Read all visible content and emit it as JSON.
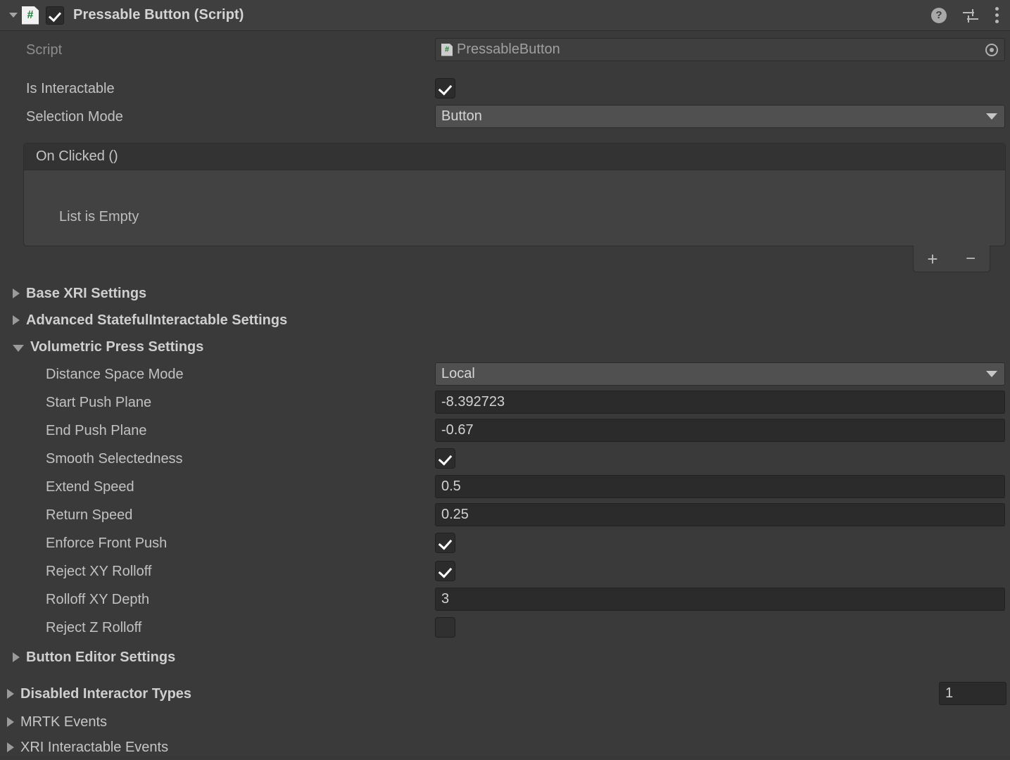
{
  "header": {
    "title": "Pressable Button (Script)",
    "enabled": true,
    "script_icon": "csharp-script-icon",
    "hash": "#",
    "icons": {
      "help": "?",
      "preset": "preset-icon",
      "menu": "kebab-menu-icon"
    }
  },
  "script_row": {
    "label": "Script",
    "value": "PressableButton",
    "hash": "#"
  },
  "fields": {
    "is_interactable": {
      "label": "Is Interactable",
      "value": true
    },
    "selection_mode": {
      "label": "Selection Mode",
      "value": "Button"
    }
  },
  "event_list": {
    "title": "On Clicked ()",
    "empty_text": "List is Empty",
    "add_label": "+",
    "remove_label": "−"
  },
  "sections": [
    {
      "label": "Base XRI Settings",
      "expanded": false,
      "bold": true
    },
    {
      "label": "Advanced StatefulInteractable Settings",
      "expanded": false,
      "bold": true
    },
    {
      "label": "Volumetric Press Settings",
      "expanded": true,
      "bold": true
    },
    {
      "label": "Button Editor Settings",
      "expanded": false,
      "bold": true
    },
    {
      "label": "Disabled Interactor Types",
      "expanded": false,
      "bold": true
    },
    {
      "label": "MRTK Events",
      "expanded": false,
      "bold": false
    },
    {
      "label": "XRI Interactable Events",
      "expanded": false,
      "bold": false
    }
  ],
  "volumetric": {
    "distance_space_mode": {
      "label": "Distance Space Mode",
      "value": "Local",
      "type": "dropdown"
    },
    "start_push_plane": {
      "label": "Start Push Plane",
      "value": "-8.392723",
      "type": "number"
    },
    "end_push_plane": {
      "label": "End Push Plane",
      "value": "-0.67",
      "type": "number"
    },
    "smooth_selectedness": {
      "label": "Smooth Selectedness",
      "value": true,
      "type": "checkbox"
    },
    "extend_speed": {
      "label": "Extend Speed",
      "value": "0.5",
      "type": "number"
    },
    "return_speed": {
      "label": "Return Speed",
      "value": "0.25",
      "type": "number"
    },
    "enforce_front_push": {
      "label": "Enforce Front Push",
      "value": true,
      "type": "checkbox"
    },
    "reject_xy_rolloff": {
      "label": "Reject XY Rolloff",
      "value": true,
      "type": "checkbox"
    },
    "rolloff_xy_depth": {
      "label": "Rolloff XY Depth",
      "value": "3",
      "type": "number"
    },
    "reject_z_rolloff": {
      "label": "Reject Z Rolloff",
      "value": false,
      "type": "checkbox"
    }
  },
  "disabled_interactor_types": {
    "size_value": "1"
  },
  "colors": {
    "background": "#3a3a3a",
    "header": "#3f3f3f",
    "field": "#2b2b2b",
    "dropdown": "#505050",
    "panel_body": "#424242",
    "panel_head": "#333333",
    "text": "#c2c2c2",
    "accent_green": "#1b7a35"
  }
}
